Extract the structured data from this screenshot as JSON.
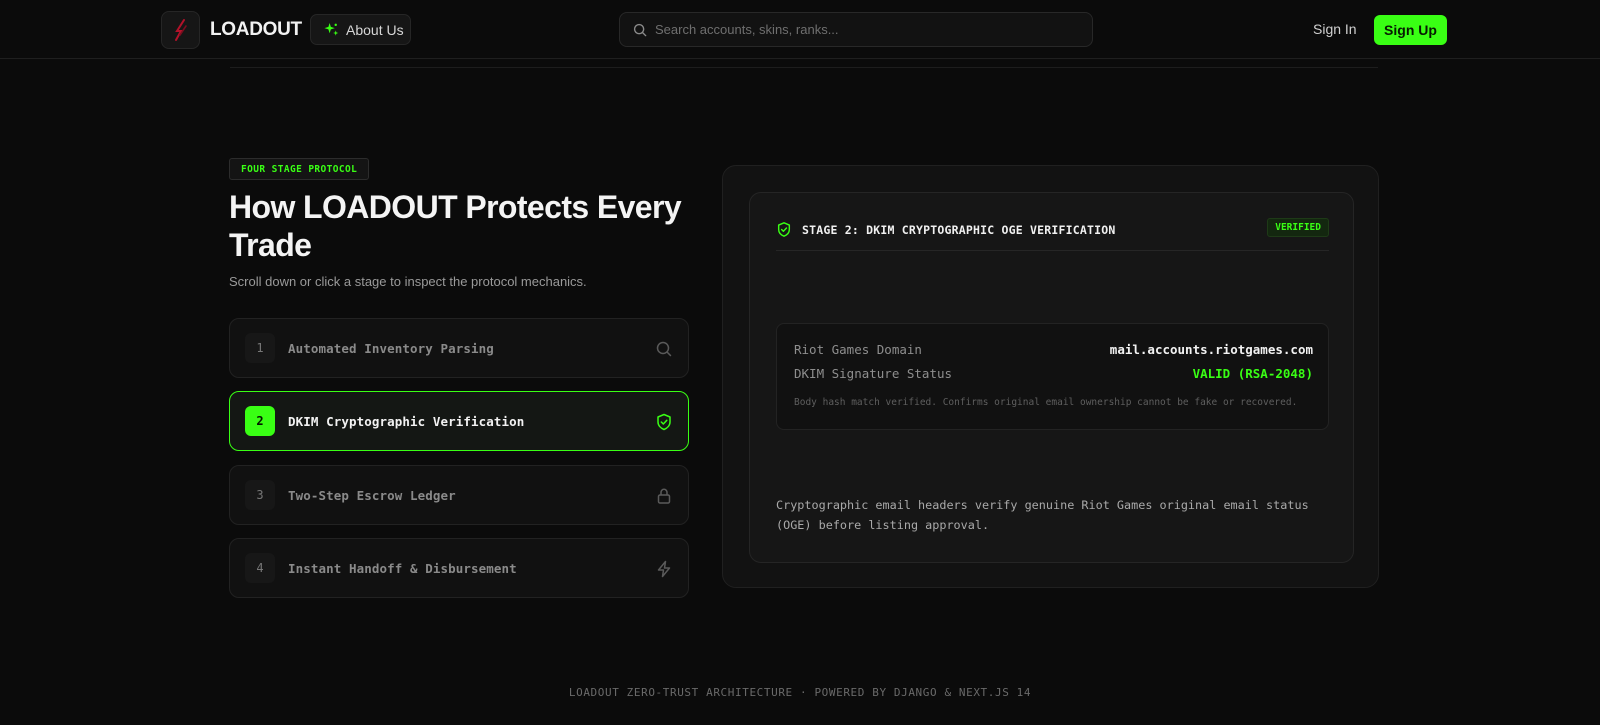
{
  "header": {
    "brand": "LOADOUT",
    "about_label": "About Us",
    "search_placeholder": "Search accounts, skins, ranks...",
    "signin_label": "Sign In",
    "signup_label": "Sign Up"
  },
  "hero": {
    "eyebrow": "FOUR STAGE PROTOCOL",
    "title": "How LOADOUT Protects Every Trade",
    "subtitle": "Scroll down or click a stage to inspect the protocol mechanics."
  },
  "stages": [
    {
      "num": "1",
      "label": "Automated Inventory Parsing",
      "icon": "search-icon",
      "active": false
    },
    {
      "num": "2",
      "label": "DKIM Cryptographic Verification",
      "icon": "shield-check-icon",
      "active": true
    },
    {
      "num": "3",
      "label": "Two-Step Escrow Ledger",
      "icon": "lock-icon",
      "active": false
    },
    {
      "num": "4",
      "label": "Instant Handoff & Disbursement",
      "icon": "lightning-icon",
      "active": false
    }
  ],
  "detail": {
    "title": "STAGE 2: DKIM CRYPTOGRAPHIC OGE VERIFICATION",
    "badge": "VERIFIED",
    "rows": [
      {
        "key": "Riot Games Domain",
        "value": "mail.accounts.riotgames.com"
      },
      {
        "key": "DKIM Signature Status",
        "value": "VALID (RSA-2048)"
      }
    ],
    "note": "Body hash match verified. Confirms original email ownership cannot be fake or recovered.",
    "description": "Cryptographic email headers verify genuine Riot Games original email status (OGE) before listing approval."
  },
  "footer": {
    "text": "LOADOUT ZERO-TRUST ARCHITECTURE · POWERED BY DJANGO & NEXT.JS 14"
  },
  "colors": {
    "accent": "#39ff14",
    "background": "#0b0b0b",
    "logo_mark": "#b3122a"
  }
}
